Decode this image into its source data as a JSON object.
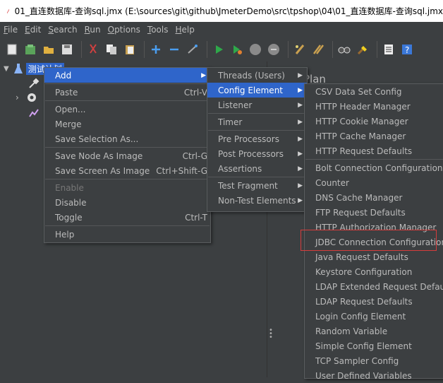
{
  "window": {
    "title": "01_直连数据库-查询sql.jmx (E:\\sources\\git\\github\\JmeterDemo\\src\\tpshop\\04\\01_直连数据库-查询sql.jmx"
  },
  "menubar": [
    "File",
    "Edit",
    "Search",
    "Run",
    "Options",
    "Tools",
    "Help"
  ],
  "toolbar": [
    "new-icon",
    "templates-icon",
    "open-icon",
    "save-icon",
    "cut-icon",
    "copy-icon",
    "paste-icon",
    "expand-icon",
    "collapse-icon",
    "toggle-icon",
    "start-icon",
    "start-no-pause-icon",
    "stop-icon",
    "shutdown-icon",
    "clear-icon",
    "clear-all-icon",
    "search-icon",
    "reset-search-icon",
    "function-helper-icon",
    "help-icon"
  ],
  "tree": {
    "root_label": "测试计划"
  },
  "right_pane": {
    "partial_label": "Plan"
  },
  "context_menu": [
    {
      "label": "Add",
      "arrow": true,
      "active": true
    },
    {
      "sep": true
    },
    {
      "label": "Paste",
      "accel": "Ctrl-V"
    },
    {
      "sep": true
    },
    {
      "label": "Open..."
    },
    {
      "label": "Merge"
    },
    {
      "label": "Save Selection As..."
    },
    {
      "sep": true
    },
    {
      "label": "Save Node As Image",
      "accel": "Ctrl-G"
    },
    {
      "label": "Save Screen As Image",
      "accel": "Ctrl+Shift-G"
    },
    {
      "sep": true
    },
    {
      "label": "Enable",
      "disabled": true
    },
    {
      "label": "Disable"
    },
    {
      "label": "Toggle",
      "accel": "Ctrl-T"
    },
    {
      "sep": true
    },
    {
      "label": "Help"
    }
  ],
  "add_menu": [
    {
      "label": "Threads (Users)",
      "arrow": true
    },
    {
      "label": "Config Element",
      "arrow": true,
      "active": true
    },
    {
      "label": "Listener",
      "arrow": true
    },
    {
      "sep": true
    },
    {
      "label": "Timer",
      "arrow": true
    },
    {
      "sep": true
    },
    {
      "label": "Pre Processors",
      "arrow": true
    },
    {
      "label": "Post Processors",
      "arrow": true
    },
    {
      "label": "Assertions",
      "arrow": true
    },
    {
      "sep": true
    },
    {
      "label": "Test Fragment",
      "arrow": true
    },
    {
      "label": "Non-Test Elements",
      "arrow": true
    }
  ],
  "config_menu": [
    {
      "label": "CSV Data Set Config"
    },
    {
      "label": "HTTP Header Manager"
    },
    {
      "label": "HTTP Cookie Manager"
    },
    {
      "label": "HTTP Cache Manager"
    },
    {
      "label": "HTTP Request Defaults"
    },
    {
      "sep": true
    },
    {
      "label": "Bolt Connection Configuration"
    },
    {
      "label": "Counter"
    },
    {
      "label": "DNS Cache Manager"
    },
    {
      "label": "FTP Request Defaults"
    },
    {
      "label": "HTTP Authorization Manager"
    },
    {
      "label": "JDBC Connection Configuration",
      "highlighted": true
    },
    {
      "label": "Java Request Defaults"
    },
    {
      "label": "Keystore Configuration"
    },
    {
      "label": "LDAP Extended Request Defaults"
    },
    {
      "label": "LDAP Request Defaults"
    },
    {
      "label": "Login Config Element"
    },
    {
      "label": "Random Variable"
    },
    {
      "label": "Simple Config Element"
    },
    {
      "label": "TCP Sampler Config"
    },
    {
      "label": "User Defined Variables"
    }
  ]
}
